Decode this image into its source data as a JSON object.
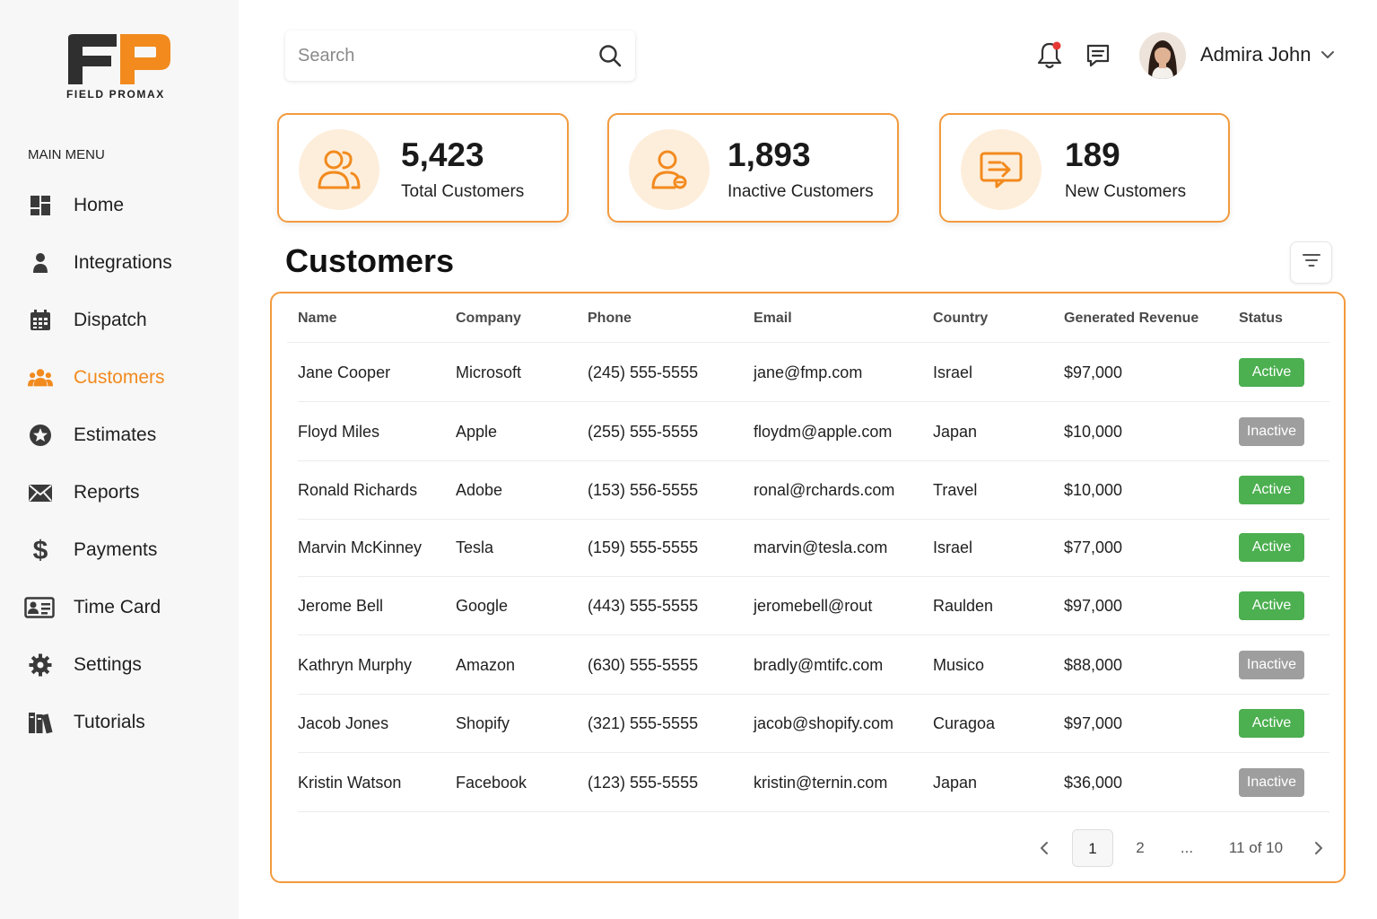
{
  "brand": {
    "logo_letters": "FP",
    "logo_text": "FIELD PROMAX",
    "primary": "#f28a1e",
    "accent_dark": "#333333"
  },
  "sidebar": {
    "menu_title": "MAIN MENU",
    "items": [
      {
        "label": "Home",
        "icon": "home-grid-icon",
        "active": false
      },
      {
        "label": "Integrations",
        "icon": "person-icon",
        "active": false
      },
      {
        "label": "Dispatch",
        "icon": "calendar-icon",
        "active": false
      },
      {
        "label": "Customers",
        "icon": "users-icon",
        "active": true
      },
      {
        "label": "Estimates",
        "icon": "star-circle-icon",
        "active": false
      },
      {
        "label": "Reports",
        "icon": "envelope-icon",
        "active": false
      },
      {
        "label": "Payments",
        "icon": "dollar-icon",
        "active": false
      },
      {
        "label": "Time Card",
        "icon": "id-card-icon",
        "active": false
      },
      {
        "label": "Settings",
        "icon": "gear-icon",
        "active": false
      },
      {
        "label": "Tutorials",
        "icon": "books-icon",
        "active": false
      }
    ]
  },
  "topbar": {
    "search_placeholder": "Search",
    "user_name": "Admira John",
    "notification_dot_color": "#e53935"
  },
  "stats": [
    {
      "value": "5,423",
      "label": "Total Customers",
      "icon": "users-icon"
    },
    {
      "value": "1,893",
      "label": "Inactive Customers",
      "icon": "user-remove-icon"
    },
    {
      "value": "189",
      "label": "New Customers",
      "icon": "inbox-arrow-icon"
    }
  ],
  "customers": {
    "title": "Customers",
    "columns": [
      "Name",
      "Company",
      "Phone",
      "Email",
      "Country",
      "Generated Revenue",
      "Status"
    ],
    "rows": [
      {
        "name": "Jane Cooper",
        "company": "Microsoft",
        "phone": "(245) 555-5555",
        "email": "jane@fmp.com",
        "country": "Israel",
        "revenue": "$97,000",
        "status": "Active"
      },
      {
        "name": "Floyd Miles",
        "company": "Apple",
        "phone": "(255) 555-5555",
        "email": "floydm@apple.com",
        "country": "Japan",
        "revenue": "$10,000",
        "status": "Inactive"
      },
      {
        "name": "Ronald Richards",
        "company": "Adobe",
        "phone": "(153) 556-5555",
        "email": "ronal@rchards.com",
        "country": "Travel",
        "revenue": "$10,000",
        "status": "Active"
      },
      {
        "name": "Marvin McKinney",
        "company": "Tesla",
        "phone": "(159) 555-5555",
        "email": "marvin@tesla.com",
        "country": "Israel",
        "revenue": "$77,000",
        "status": "Active"
      },
      {
        "name": "Jerome Bell",
        "company": "Google",
        "phone": "(443) 555-5555",
        "email": "jeromebell@rout",
        "country": "Raulden",
        "revenue": "$97,000",
        "status": "Active"
      },
      {
        "name": "Kathryn Murphy",
        "company": "Amazon",
        "phone": "(630) 555-5555",
        "email": "bradly@mtifc.com",
        "country": "Musico",
        "revenue": "$88,000",
        "status": "Inactive"
      },
      {
        "name": "Jacob Jones",
        "company": "Shopify",
        "phone": "(321) 555-5555",
        "email": "jacob@shopify.com",
        "country": "Curagoa",
        "revenue": "$97,000",
        "status": "Active"
      },
      {
        "name": "Kristin Watson",
        "company": "Facebook",
        "phone": "(123) 555-5555",
        "email": "kristin@ternin.com",
        "country": "Japan",
        "revenue": "$36,000",
        "status": "Inactive"
      }
    ],
    "status_colors": {
      "Active": "#4caf50",
      "Inactive": "#9e9e9e"
    }
  },
  "pagination": {
    "current": "1",
    "next": "2",
    "ellipsis": "...",
    "summary": "11 of 10"
  }
}
